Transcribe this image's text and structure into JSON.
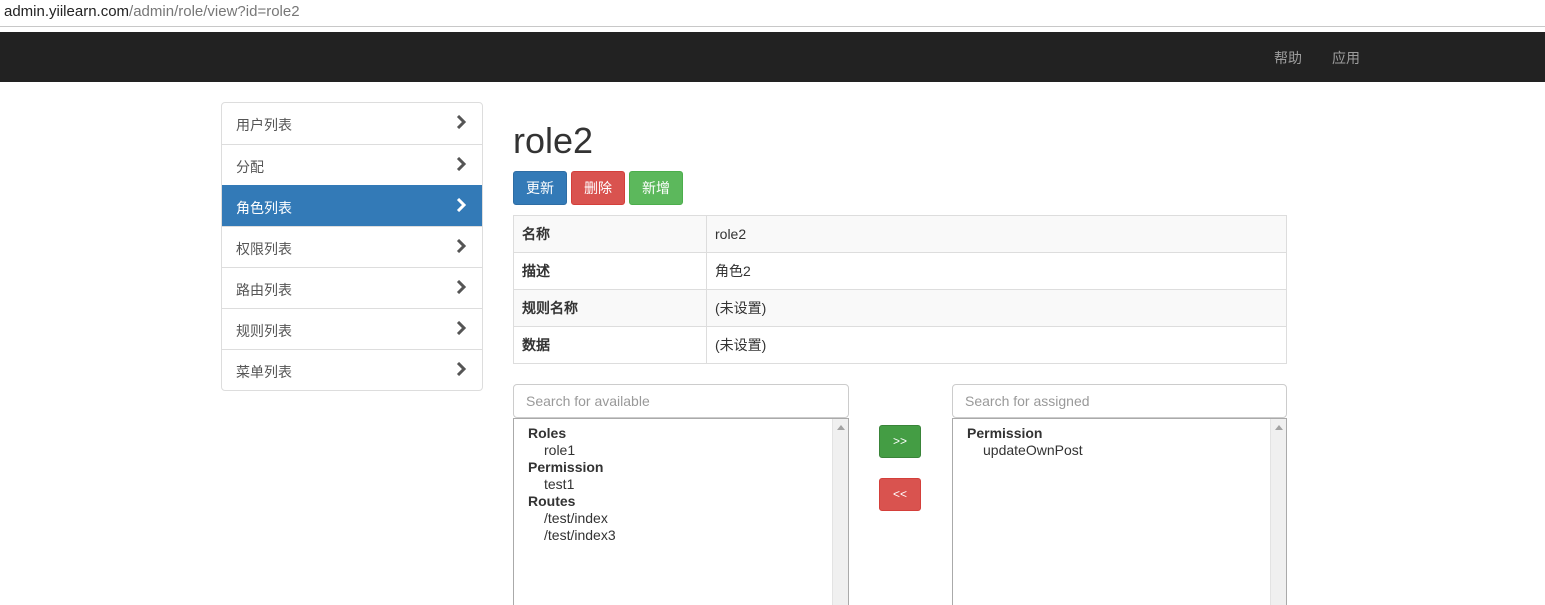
{
  "browser": {
    "url_host": "admin.yiilearn.com",
    "url_path": "/admin/role/view?id=role2"
  },
  "navbar": {
    "help": "帮助",
    "apps": "应用"
  },
  "sidebar": {
    "items": [
      {
        "label": "用户列表"
      },
      {
        "label": "分配"
      },
      {
        "label": "角色列表"
      },
      {
        "label": "权限列表"
      },
      {
        "label": "路由列表"
      },
      {
        "label": "规则列表"
      },
      {
        "label": "菜单列表"
      }
    ],
    "active_index": 2
  },
  "page": {
    "title": "role2",
    "buttons": {
      "update": "更新",
      "delete": "删除",
      "create": "新增"
    }
  },
  "detail": {
    "rows": [
      {
        "key": "名称",
        "value": "role2"
      },
      {
        "key": "描述",
        "value": "角色2"
      },
      {
        "key": "规则名称",
        "value": "(未设置)"
      },
      {
        "key": "数据",
        "value": "(未设置)"
      }
    ]
  },
  "assignment": {
    "available_placeholder": "Search for available",
    "assigned_placeholder": "Search for assigned",
    "add_label": ">>",
    "remove_label": "<<",
    "available": {
      "roles_label": "Roles",
      "roles": [
        "role1"
      ],
      "permission_label": "Permission",
      "permissions": [
        "test1"
      ],
      "routes_label": "Routes",
      "routes": [
        "/test/index",
        "/test/index3"
      ]
    },
    "assigned": {
      "permission_label": "Permission",
      "permissions": [
        "updateOwnPost"
      ]
    }
  },
  "colors": {
    "navbar_bg": "#222222",
    "primary": "#337ab7",
    "danger": "#d9534f",
    "success": "#5cb85c"
  }
}
